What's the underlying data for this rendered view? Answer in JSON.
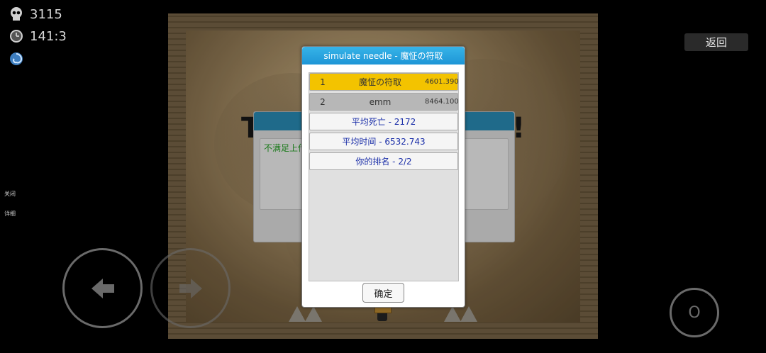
{
  "hud": {
    "deaths": "3115",
    "time": "141:3",
    "icons": [
      "skull-icon",
      "clock-icon",
      "swirl-icon"
    ]
  },
  "side_links": {
    "close": "关闭",
    "detail": "详细"
  },
  "back_button": "返回",
  "background_panel": {
    "text": "不满足上传"
  },
  "dialog": {
    "title": "simulate needle - 魔怔の符取",
    "rankings": [
      {
        "rank": "1",
        "name": "魔怔の符取",
        "score": "4601.390",
        "highlight": "#f3c300"
      },
      {
        "rank": "2",
        "name": "emm",
        "score": "8464.100",
        "highlight": "#b7b7b7"
      }
    ],
    "stats": {
      "avg_deaths": "平均死亡 - 2172",
      "avg_time": "平均时间 - 6532.743",
      "your_rank": "你的排名 - 2/2"
    },
    "ok_button": "确定"
  },
  "controls": {
    "jump_label": "O"
  },
  "colors": {
    "dialog_header": "#2aa6e0",
    "stat_text": "#1a2ea8",
    "gold_row": "#f3c300"
  }
}
